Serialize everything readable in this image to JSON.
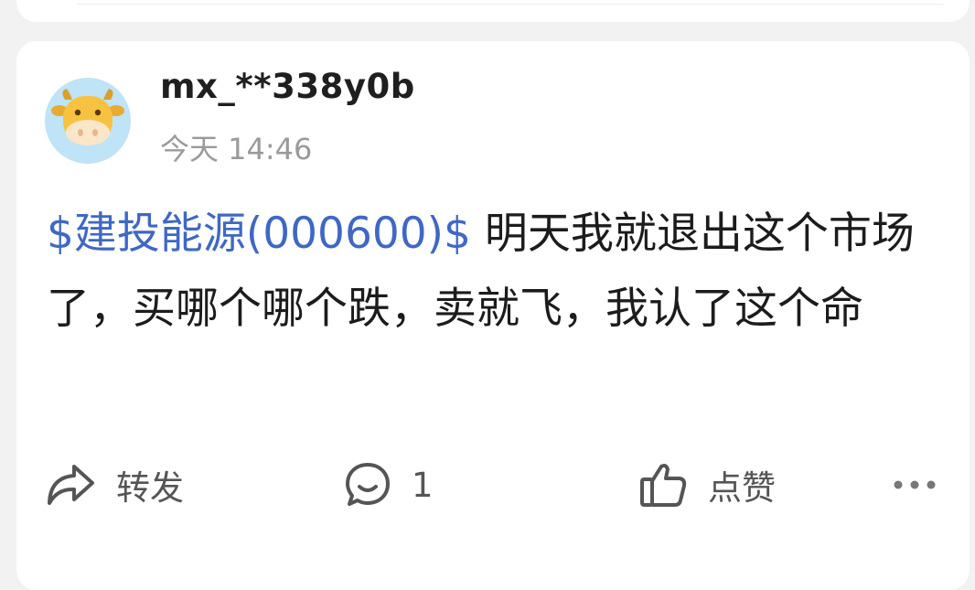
{
  "post": {
    "username": "mx_**338y0b",
    "time": "今天 14:46",
    "stock_tag": "$建投能源(000600)$",
    "text": " 明天我就退出这个市场了，买哪个哪个跌，卖就飞，我认了这个命"
  },
  "actions": {
    "repost_label": "转发",
    "comment_count": "1",
    "like_label": "点赞"
  },
  "icons": {
    "avatar": "cartoon-cow-avatar",
    "repost": "share-arrow-icon",
    "comment": "chat-bubble-icon",
    "like": "thumbs-up-icon",
    "more": "more-dots-icon"
  },
  "colors": {
    "stock_link": "#3f68c5",
    "avatar_bg": "#bfe3f7",
    "cow": "#f7c242",
    "muted_text": "#9a9a9a"
  }
}
